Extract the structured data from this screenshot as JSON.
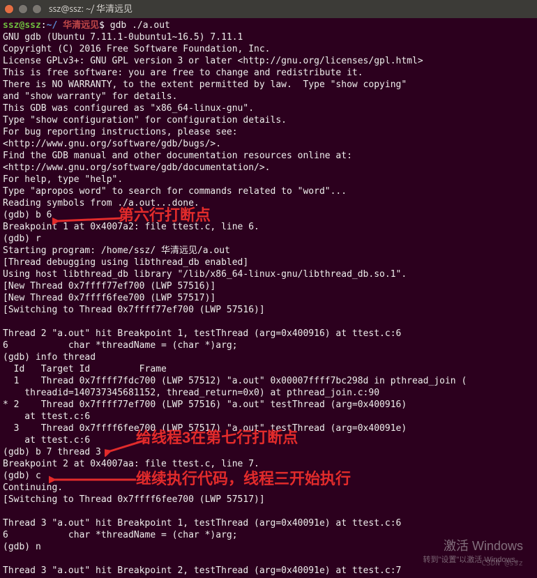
{
  "window": {
    "title": "ssz@ssz: ~/ 华清远见"
  },
  "prompt": {
    "user": "ssz",
    "host": "ssz",
    "path": "~/",
    "path2": "华清远见",
    "symbol": "$",
    "cmd": "gdb ./a.out"
  },
  "lines": {
    "l01": "GNU gdb (Ubuntu 7.11.1-0ubuntu1~16.5) 7.11.1",
    "l02": "Copyright (C) 2016 Free Software Foundation, Inc.",
    "l03": "License GPLv3+: GNU GPL version 3 or later <http://gnu.org/licenses/gpl.html>",
    "l04": "This is free software: you are free to change and redistribute it.",
    "l05": "There is NO WARRANTY, to the extent permitted by law.  Type \"show copying\"",
    "l06": "and \"show warranty\" for details.",
    "l07": "This GDB was configured as \"x86_64-linux-gnu\".",
    "l08": "Type \"show configuration\" for configuration details.",
    "l09": "For bug reporting instructions, please see:",
    "l10": "<http://www.gnu.org/software/gdb/bugs/>.",
    "l11": "Find the GDB manual and other documentation resources online at:",
    "l12": "<http://www.gnu.org/software/gdb/documentation/>.",
    "l13": "For help, type \"help\".",
    "l14": "Type \"apropos word\" to search for commands related to \"word\"...",
    "l15": "Reading symbols from ./a.out...done.",
    "l16": "(gdb) b 6",
    "l17": "Breakpoint 1 at 0x4007a2: file ttest.c, line 6.",
    "l18": "(gdb) r",
    "l19": "Starting program: /home/ssz/ 华清远见/a.out",
    "l20": "[Thread debugging using libthread_db enabled]",
    "l21": "Using host libthread_db library \"/lib/x86_64-linux-gnu/libthread_db.so.1\".",
    "l22": "[New Thread 0x7ffff77ef700 (LWP 57516)]",
    "l23": "[New Thread 0x7ffff6fee700 (LWP 57517)]",
    "l24": "[Switching to Thread 0x7ffff77ef700 (LWP 57516)]",
    "l25": "",
    "l26": "Thread 2 \"a.out\" hit Breakpoint 1, testThread (arg=0x400916) at ttest.c:6",
    "l27": "6           char *threadName = (char *)arg;",
    "l28": "(gdb) info thread",
    "l29": "  Id   Target Id         Frame",
    "l30": "  1    Thread 0x7ffff7fdc700 (LWP 57512) \"a.out\" 0x00007ffff7bc298d in pthread_join (",
    "l31": "    threadid=140737345681152, thread_return=0x0) at pthread_join.c:90",
    "l32": "* 2    Thread 0x7ffff77ef700 (LWP 57516) \"a.out\" testThread (arg=0x400916)",
    "l33": "    at ttest.c:6",
    "l34": "  3    Thread 0x7ffff6fee700 (LWP 57517) \"a.out\" testThread (arg=0x40091e)",
    "l35": "    at ttest.c:6",
    "l36": "(gdb) b 7 thread 3",
    "l37": "Breakpoint 2 at 0x4007aa: file ttest.c, line 7.",
    "l38": "(gdb) c",
    "l39": "Continuing.",
    "l40": "[Switching to Thread 0x7ffff6fee700 (LWP 57517)]",
    "l41": "",
    "l42": "Thread 3 \"a.out\" hit Breakpoint 1, testThread (arg=0x40091e) at ttest.c:6",
    "l43": "6           char *threadName = (char *)arg;",
    "l44": "(gdb) n",
    "l45": "",
    "l46": "Thread 3 \"a.out\" hit Breakpoint 2, testThread (arg=0x40091e) at ttest.c:7"
  },
  "annotations": {
    "a1": "第六行打断点",
    "a2": "给线程3在第七行打断点",
    "a3": "继续执行代码，线程三开始执行"
  },
  "watermark": {
    "line1": "激活 Windows",
    "line2": "转到\"设置\"以激活 Windows。",
    "csdn": "CSDN @ssz"
  }
}
